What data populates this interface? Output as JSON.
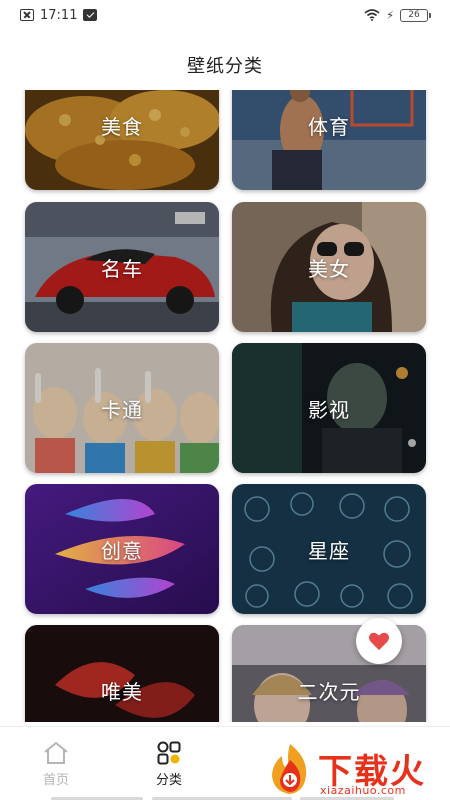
{
  "status_bar": {
    "time": "17:11",
    "battery": "26"
  },
  "header": {
    "title": "壁纸分类"
  },
  "categories": [
    {
      "label": "美食",
      "icon": "food-image"
    },
    {
      "label": "体育",
      "icon": "sports-image"
    },
    {
      "label": "名车",
      "icon": "car-image"
    },
    {
      "label": "美女",
      "icon": "woman-image"
    },
    {
      "label": "卡通",
      "icon": "cartoon-image"
    },
    {
      "label": "影视",
      "icon": "film-image"
    },
    {
      "label": "创意",
      "icon": "creative-image"
    },
    {
      "label": "星座",
      "icon": "zodiac-image"
    },
    {
      "label": "唯美",
      "icon": "aesthetic-image"
    },
    {
      "label": "二次元",
      "icon": "anime-image"
    }
  ],
  "tab_bar": {
    "home_label": "首页",
    "category_label": "分类"
  },
  "watermark": {
    "brand": "下载火",
    "domain": "xiazaihuo.com"
  },
  "colors": {
    "accent_red": "#e8311b",
    "heart": "#e64a4a"
  }
}
